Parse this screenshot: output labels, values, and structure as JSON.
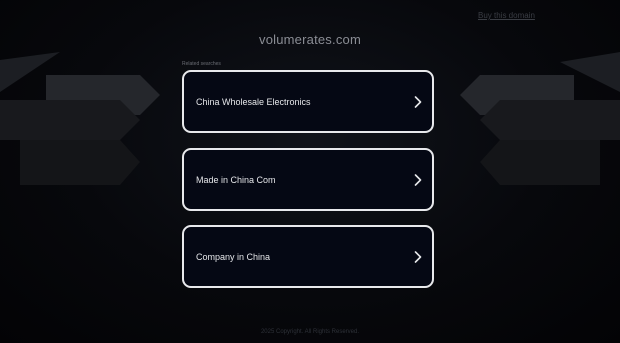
{
  "header": {
    "top_link": "Buy this domain",
    "domain": "volumerates.com"
  },
  "related": {
    "label": "Related searches",
    "items": [
      {
        "label": "China Wholesale Electronics"
      },
      {
        "label": "Made in China Com"
      },
      {
        "label": "Company in China"
      }
    ]
  },
  "footer": {
    "text": "2025 Copyright. All Rights Reserved."
  },
  "colors": {
    "background": "#050507",
    "card_border": "#e8e9ec",
    "card_fill": "#050814",
    "text": "#e6e7ea"
  }
}
